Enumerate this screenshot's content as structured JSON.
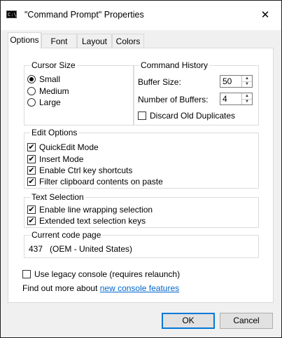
{
  "window": {
    "title": "\"Command Prompt\" Properties",
    "app_icon_text": "C:\\."
  },
  "tabs": [
    {
      "label": "Options",
      "active": true
    },
    {
      "label": "Font",
      "active": false
    },
    {
      "label": "Layout",
      "active": false
    },
    {
      "label": "Colors",
      "active": false
    }
  ],
  "cursor_size": {
    "title": "Cursor Size",
    "options": [
      "Small",
      "Medium",
      "Large"
    ],
    "selected": "Small"
  },
  "command_history": {
    "title": "Command History",
    "buffer_size_label": "Buffer Size:",
    "buffer_size_value": "50",
    "num_buffers_label": "Number of Buffers:",
    "num_buffers_value": "4",
    "discard_label": "Discard Old Duplicates",
    "discard_checked": false
  },
  "edit_options": {
    "title": "Edit Options",
    "items": [
      {
        "label": "QuickEdit Mode",
        "checked": true
      },
      {
        "label": "Insert Mode",
        "checked": true
      },
      {
        "label": "Enable Ctrl key shortcuts",
        "checked": true
      },
      {
        "label": "Filter clipboard contents on paste",
        "checked": true
      }
    ]
  },
  "text_selection": {
    "title": "Text Selection",
    "items": [
      {
        "label": "Enable line wrapping selection",
        "checked": true
      },
      {
        "label": "Extended text selection keys",
        "checked": true
      }
    ]
  },
  "code_page": {
    "title": "Current code page",
    "value": "437   (OEM - United States)"
  },
  "legacy": {
    "label": "Use legacy console (requires relaunch)",
    "checked": false
  },
  "find_out": {
    "prefix": "Find out more about ",
    "link": "new console features"
  },
  "buttons": {
    "ok": "OK",
    "cancel": "Cancel"
  },
  "icons": {
    "close": "close-icon",
    "check": "checkmark-icon"
  }
}
